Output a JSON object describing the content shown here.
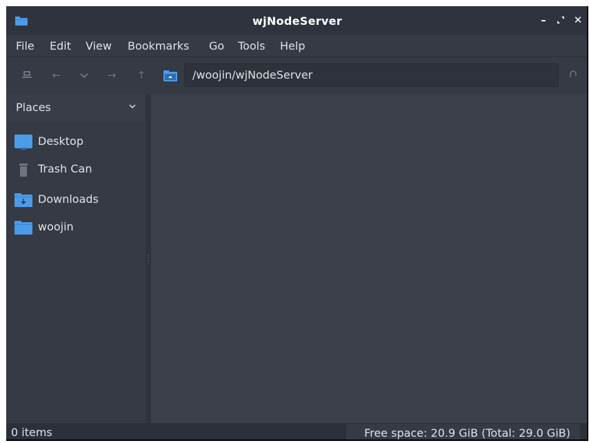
{
  "window": {
    "title": "wjNodeServer"
  },
  "menubar": {
    "items": [
      "File",
      "Edit",
      "View",
      "Bookmarks",
      "Go",
      "Tools",
      "Help"
    ]
  },
  "toolbar": {
    "path": "/woojin/wjNodeServer"
  },
  "sidebar": {
    "header": "Places",
    "items": [
      {
        "label": "Desktop",
        "icon": "desktop-icon"
      },
      {
        "label": "Trash Can",
        "icon": "trash-icon"
      },
      {
        "label": "Downloads",
        "icon": "downloads-folder-icon"
      },
      {
        "label": "woojin",
        "icon": "home-folder-icon"
      }
    ]
  },
  "statusbar": {
    "item_count": "0 items",
    "free_space": "Free space: 20.9 GiB (Total: 29.0 GiB)"
  },
  "colors": {
    "window_bg": "#353a44",
    "content_bg": "#3b404b",
    "titlebar_bg": "#2f333d",
    "folder_blue": "#4c9be8",
    "text": "#dfe2e7"
  }
}
